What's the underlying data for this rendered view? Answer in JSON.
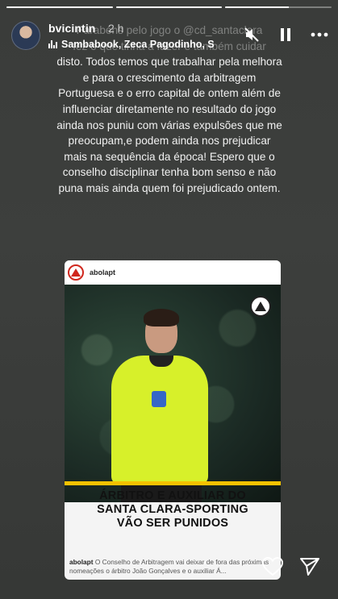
{
  "progress": [
    {
      "fill": 1.0
    },
    {
      "fill": 1.0
    },
    {
      "fill": 0.6
    }
  ],
  "header": {
    "username": "bvicintin",
    "time": "2 h",
    "music": "Sambabook, Zeca Pagodinho, S",
    "icons": {
      "mute": "muted-speaker-icon",
      "pause": "pause-icon",
      "more": "more-dots-icon"
    }
  },
  "story_text": {
    "line_faded_1": "Parabéns pelo jogo o @cd_santaclara",
    "line_faded_2": "fez o que tinha a fazer e também cuidar",
    "body": "disto. Todos temos que trabalhar pela melhora e para o crescimento da arbitragem Portuguesa e o erro capital de ontem além de influenciar diretamente no resultado do jogo ainda nos puniu com várias expulsões que me preocupam,e podem ainda nos prejudicar mais na sequência da época! Espero que o conselho disciplinar tenha bom senso e não puna mais ainda quem foi prejudicado ontem."
  },
  "post": {
    "username": "abolapt",
    "headline_1": "ÁRBITRO E AUXILIAR DO",
    "headline_2": "SANTA CLARA-SPORTING",
    "headline_3": "VÃO SER PUNIDOS",
    "caption_user": "abolapt",
    "caption_text": "O Conselho de Arbitragem vai deixar de fora das próximas nomeações o árbitro João Gonçalves e o auxiliar Á..."
  },
  "footer": {
    "icons": {
      "like": "heart-icon",
      "share": "send-icon"
    }
  },
  "colors": {
    "background": "#3b3d3b",
    "brand_red": "#d0271d",
    "headline_yellow": "#f5c200",
    "ref_shirt": "#d7f02a"
  }
}
